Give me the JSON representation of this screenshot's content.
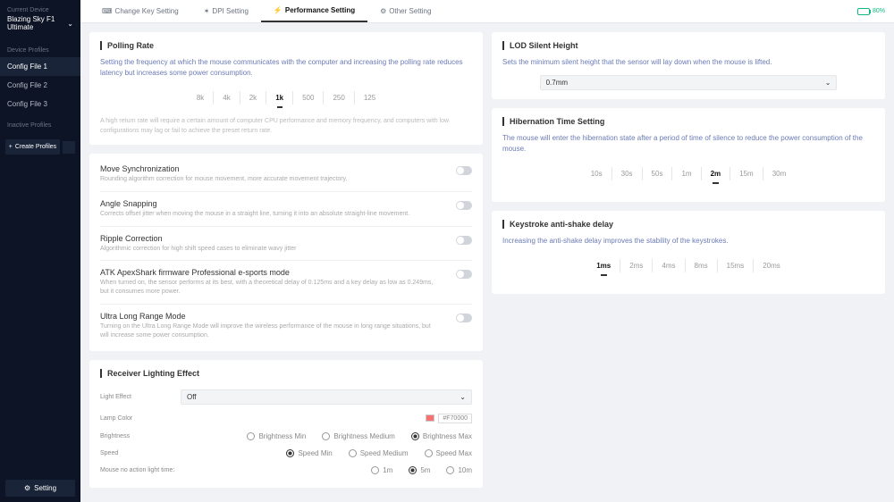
{
  "sidebar": {
    "current_label": "Current Device",
    "device": "Blazing Sky F1 Ultimate",
    "device_profiles_label": "Device Profiles",
    "profiles": [
      "Config File 1",
      "Config File 2",
      "Config File 3"
    ],
    "inactive_label": "Inactive Profiles",
    "create_label": "Create Profiles",
    "setting_label": "Setting"
  },
  "tabs": {
    "items": [
      "Change Key Setting",
      "DPI Setting",
      "Performance Setting",
      "Other Setting"
    ],
    "battery": "80%"
  },
  "polling": {
    "title": "Polling Rate",
    "desc": "Setting the frequency at which the mouse communicates with the computer and increasing the polling rate reduces latency but increases some power consumption.",
    "options": [
      "8k",
      "4k",
      "2k",
      "1k",
      "500",
      "250",
      "125"
    ],
    "note": "A high return rate will require a certain amount of computer CPU performance and memory frequency, and computers with low configurations may lag or fail to achieve the preset return rate."
  },
  "toggles": [
    {
      "title": "Move Synchronization",
      "desc": "Rounding algorithm correction for mouse movement, more accurate movement trajectory."
    },
    {
      "title": "Angle Snapping",
      "desc": "Corrects offset jitter when moving the mouse in a straight line, turning it into an absolute straight-line movement."
    },
    {
      "title": "Ripple Correction",
      "desc": "Algorithmic correction for high shift speed cases to eliminate wavy jitter"
    },
    {
      "title": "ATK ApexShark firmware Professional e-sports mode",
      "desc": "When turned on, the sensor performs at its best, with a theoretical delay of 0.125ms and a key delay as low as 0.249ms, but it consumes more power."
    },
    {
      "title": "Ultra Long Range Mode",
      "desc": "Turning on the Ultra Long Range Mode will improve the wireless performance of the mouse in long range situations, but will increase some power consumption."
    }
  ],
  "lighting": {
    "title": "Receiver Lighting Effect",
    "effect_label": "Light Effect",
    "effect_value": "Off",
    "color_label": "Lamp Color",
    "color_hex": "#F70000",
    "brightness_label": "Brightness",
    "brightness_opts": [
      "Brightness Min",
      "Brightness Medium",
      "Brightness Max"
    ],
    "speed_label": "Speed",
    "speed_opts": [
      "Speed Min",
      "Speed Medium",
      "Speed Max"
    ],
    "noaction_label": "Mouse no action light time:",
    "noaction_opts": [
      "1m",
      "5m",
      "10m"
    ]
  },
  "lod": {
    "title": "LOD Silent Height",
    "desc": "Sets the minimum silent height that the sensor will lay down when the mouse is lifted.",
    "value": "0.7mm"
  },
  "hibernation": {
    "title": "Hibernation Time Setting",
    "desc": "The mouse will enter the hibernation state after a period of time of silence to reduce the power consumption of the mouse.",
    "options": [
      "10s",
      "30s",
      "50s",
      "1m",
      "2m",
      "15m",
      "30m"
    ]
  },
  "antishake": {
    "title": "Keystroke anti-shake delay",
    "desc": "Increasing the anti-shake delay improves the stability of the keystrokes.",
    "options": [
      "1ms",
      "2ms",
      "4ms",
      "8ms",
      "15ms",
      "20ms"
    ]
  }
}
